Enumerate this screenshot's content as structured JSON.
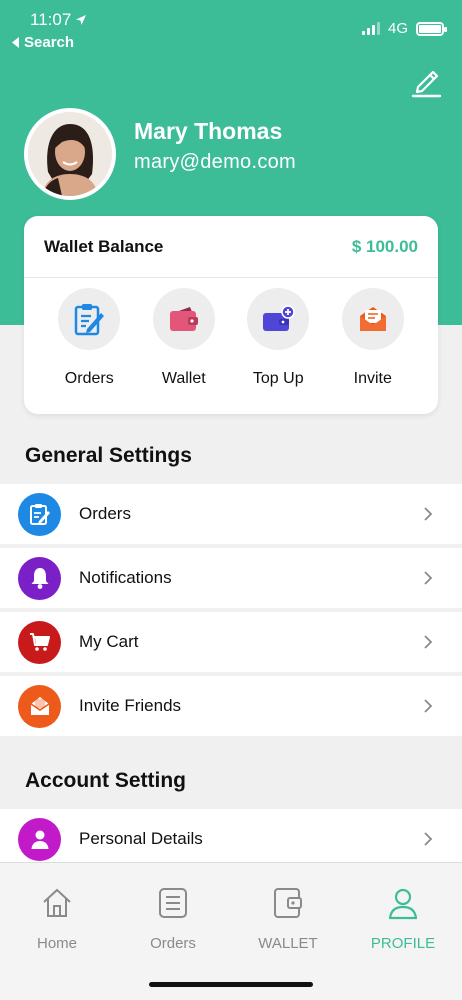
{
  "status_bar": {
    "time": "11:07",
    "back_label": "Search",
    "network": "4G"
  },
  "profile": {
    "name": "Mary Thomas",
    "email": "mary@demo.com"
  },
  "wallet": {
    "title": "Wallet Balance",
    "amount": "$ 100.00"
  },
  "quick_actions": [
    {
      "label": "Orders",
      "icon": "clipboard-icon"
    },
    {
      "label": "Wallet",
      "icon": "wallet-icon"
    },
    {
      "label": "Top Up",
      "icon": "topup-card-icon"
    },
    {
      "label": "Invite",
      "icon": "envelope-icon"
    }
  ],
  "general_settings": {
    "title": "General Settings",
    "items": [
      {
        "label": "Orders",
        "icon": "clipboard-icon",
        "color": "#1e88e5"
      },
      {
        "label": "Notifications",
        "icon": "bell-icon",
        "color": "#7b1fc7"
      },
      {
        "label": "My Cart",
        "icon": "cart-icon",
        "color": "#c81a1a"
      },
      {
        "label": "Invite Friends",
        "icon": "envelope-icon",
        "color": "#ee5a1c"
      }
    ]
  },
  "account_setting": {
    "title": "Account Setting",
    "items": [
      {
        "label": "Personal Details",
        "icon": "person-icon",
        "color": "#c21ac9"
      }
    ]
  },
  "tabs": [
    {
      "label": "Home",
      "icon": "home-icon",
      "active": false
    },
    {
      "label": "Orders",
      "icon": "list-icon",
      "active": false
    },
    {
      "label": "WALLET",
      "icon": "wallet-icon",
      "active": false
    },
    {
      "label": "PROFILE",
      "icon": "person-icon",
      "active": true
    }
  ],
  "colors": {
    "accent": "#3dbc98",
    "background": "#f0f0f0"
  }
}
